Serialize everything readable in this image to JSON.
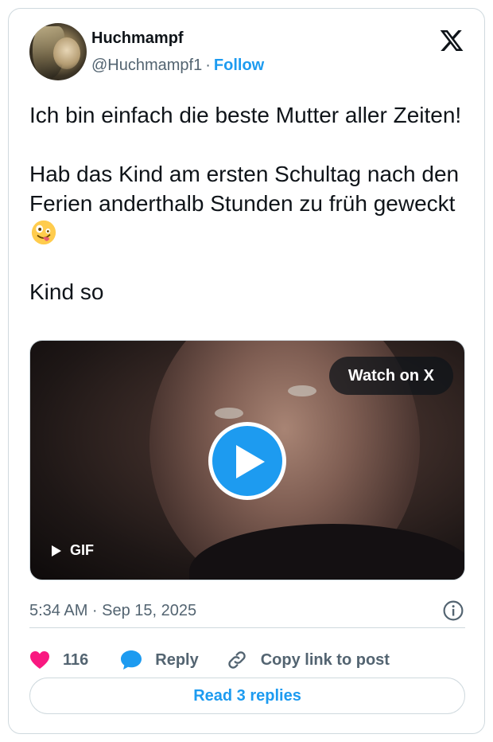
{
  "author": {
    "display_name": "Huchmampf",
    "handle": "@Huchmampf1",
    "separator": "·",
    "follow_label": "Follow"
  },
  "brand_icon": "x-logo-icon",
  "tweet": {
    "line1": "Ich bin einfach die beste Mutter aller Zeiten!",
    "line2": "Hab das Kind am ersten Schultag nach den Ferien anderthalb Stunden zu früh geweckt",
    "line2_emoji": "zany-face-emoji",
    "line3": "Kind so"
  },
  "media": {
    "watch_label": "Watch on X",
    "gif_label": "GIF",
    "play_icon": "play-icon"
  },
  "meta": {
    "timestamp": "5:34 AM · Sep 15, 2025",
    "info_icon": "info-icon"
  },
  "actions": {
    "like_count": "116",
    "reply_label": "Reply",
    "copy_label": "Copy link to post"
  },
  "footer": {
    "read_replies_label": "Read 3 replies"
  },
  "colors": {
    "accent": "#1d9bf0",
    "heart": "#f91880",
    "text": "#0f1419",
    "muted": "#536471",
    "border": "#cfd9de"
  }
}
